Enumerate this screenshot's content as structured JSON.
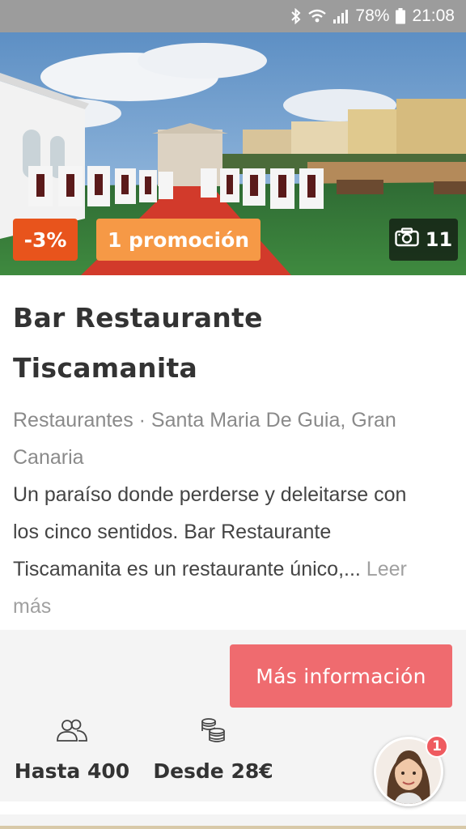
{
  "status_bar": {
    "battery": "78%",
    "time": "21:08"
  },
  "hero": {
    "discount": "-3%",
    "promotion": "1 promoción",
    "photo_count": "11"
  },
  "listing": {
    "title_line1": "Bar Restaurante",
    "title_line2": "Tiscamanita",
    "meta_line1": "Restaurantes · Santa Maria De Guia, Gran",
    "meta_line2": "Canaria",
    "description_line1": "Un paraíso donde perderse y deleitarse con",
    "description_line2": "los cinco sentidos. Bar Restaurante",
    "description_line3": "Tiscamanita es un restaurante único,... ",
    "read_more_a": "Leer",
    "read_more_b": "más"
  },
  "footer": {
    "cta_label": "Más información",
    "capacity": "Hasta 400",
    "price": "Desde 28€"
  },
  "chat": {
    "notification_count": "1"
  },
  "colors": {
    "discount": "#e8541c",
    "promotion": "#f69946",
    "cta": "#ef6b6f",
    "notification": "#ef5b60"
  }
}
